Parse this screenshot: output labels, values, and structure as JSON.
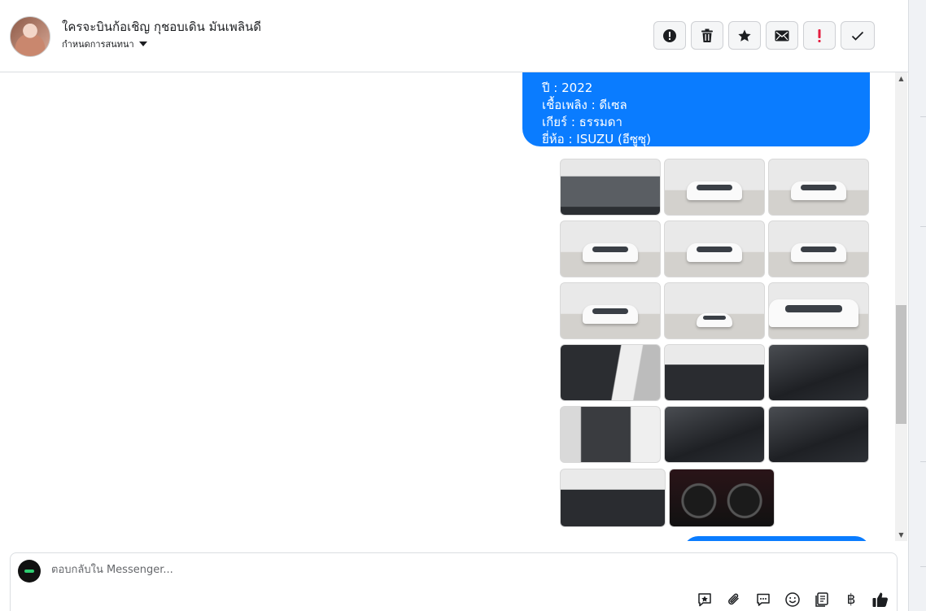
{
  "conversation": {
    "title": "ใครจะบินก้อเชิญ กุชอบเดิน มันเพลินดี",
    "label_menu": "กำหนดการสนทนา"
  },
  "actions": [
    {
      "name": "mark-spam-button",
      "icon": "alert-circle-icon"
    },
    {
      "name": "delete-button",
      "icon": "trash-icon"
    },
    {
      "name": "star-button",
      "icon": "star-icon"
    },
    {
      "name": "mark-unread-button",
      "icon": "envelope-icon"
    },
    {
      "name": "follow-up-button",
      "icon": "exclamation-icon"
    },
    {
      "name": "mark-done-button",
      "icon": "checkmark-icon"
    }
  ],
  "message": {
    "lines": [
      "ปี : 2022",
      "เชื้อเพลิง : ดีเซล",
      "เกียร์ : ธรรมดา",
      "ยี่ห้อ : ISUZU (อีซูซุ)"
    ],
    "bubble_color": "#0a7cff"
  },
  "composer": {
    "placeholder": "ตอบกลับใน Messenger...",
    "currency_symbol": "฿"
  },
  "colors": {
    "accent": "#0a7cff",
    "border": "#dadde1"
  }
}
